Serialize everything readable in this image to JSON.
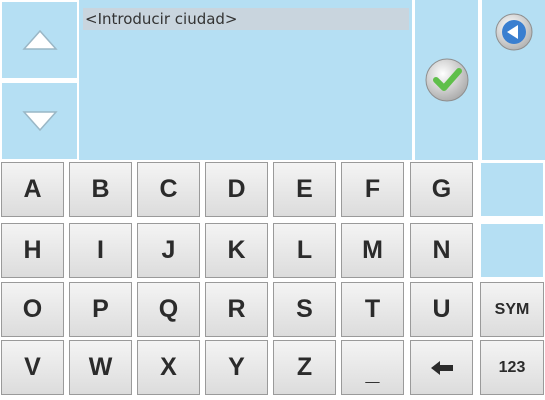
{
  "input": {
    "value": "<Introducir ciudad>"
  },
  "icons": {
    "up": "triangle-up-icon",
    "down": "triangle-down-icon",
    "confirm": "checkmark-icon",
    "back": "back-arrow-icon",
    "backspace": "backspace-arrow-icon"
  },
  "colors": {
    "panel": "#b5dff3",
    "key": "#e8e8e8",
    "confirm": "#5fbf4a",
    "back": "#3a7fd0"
  },
  "keyboard": {
    "rows": [
      [
        "A",
        "B",
        "C",
        "D",
        "E",
        "F",
        "G",
        ""
      ],
      [
        "H",
        "I",
        "J",
        "K",
        "L",
        "M",
        "N",
        ""
      ],
      [
        "O",
        "P",
        "Q",
        "R",
        "S",
        "T",
        "U",
        "SYM"
      ],
      [
        "V",
        "W",
        "X",
        "Y",
        "Z",
        "_",
        "←",
        "123"
      ]
    ]
  }
}
